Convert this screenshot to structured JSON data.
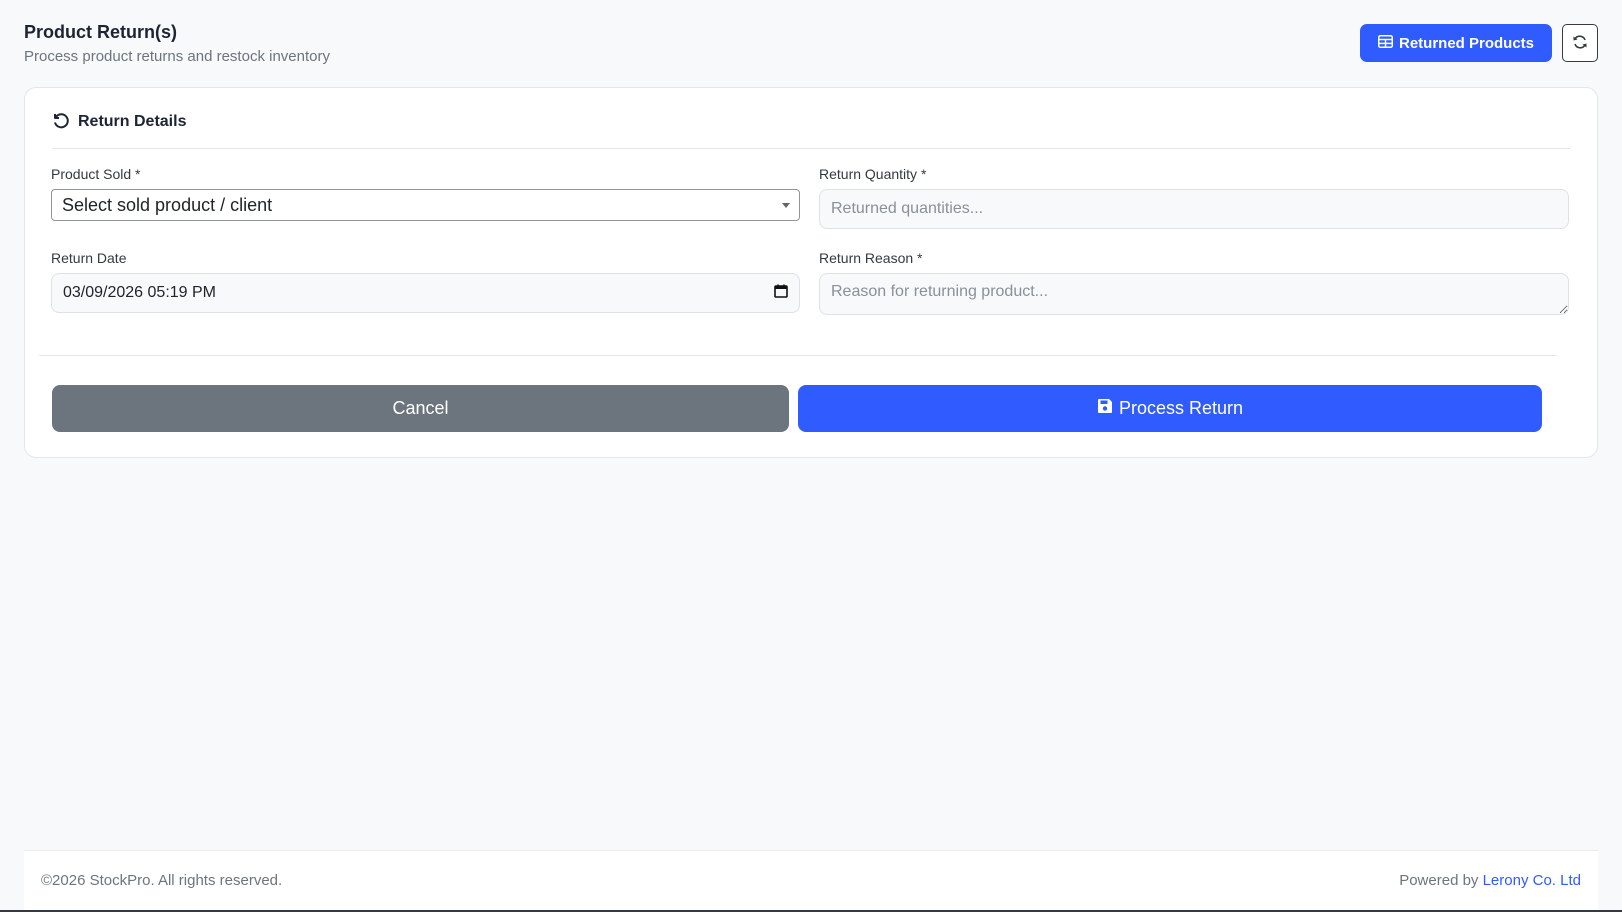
{
  "header": {
    "title": "Product Return(s)",
    "subtitle": "Process product returns and restock inventory",
    "returned_products_label": "Returned Products"
  },
  "card": {
    "title": "Return Details"
  },
  "form": {
    "product_sold_label": "Product Sold *",
    "product_sold_value": "Select sold product / client",
    "return_quantity_label": "Return Quantity *",
    "return_quantity_placeholder": "Returned quantities...",
    "return_date_label": "Return Date",
    "return_date_value": "03/09/2026 05:19  PM",
    "return_reason_label": "Return Reason *",
    "return_reason_placeholder": "Reason for returning product..."
  },
  "actions": {
    "cancel_label": "Cancel",
    "submit_label": "Process Return"
  },
  "footer": {
    "copyright": "©2026 StockPro. All rights reserved.",
    "powered_by": "Powered by ",
    "company": "Lerony Co. Ltd"
  },
  "colors": {
    "primary": "#2f5bff",
    "secondary": "#6c757d",
    "background": "#f7f9fb"
  },
  "icons": {
    "returned_products": "table-icon",
    "refresh": "refresh-icon",
    "card_title": "undo-icon",
    "date_picker": "calendar-icon",
    "submit": "save-icon"
  }
}
